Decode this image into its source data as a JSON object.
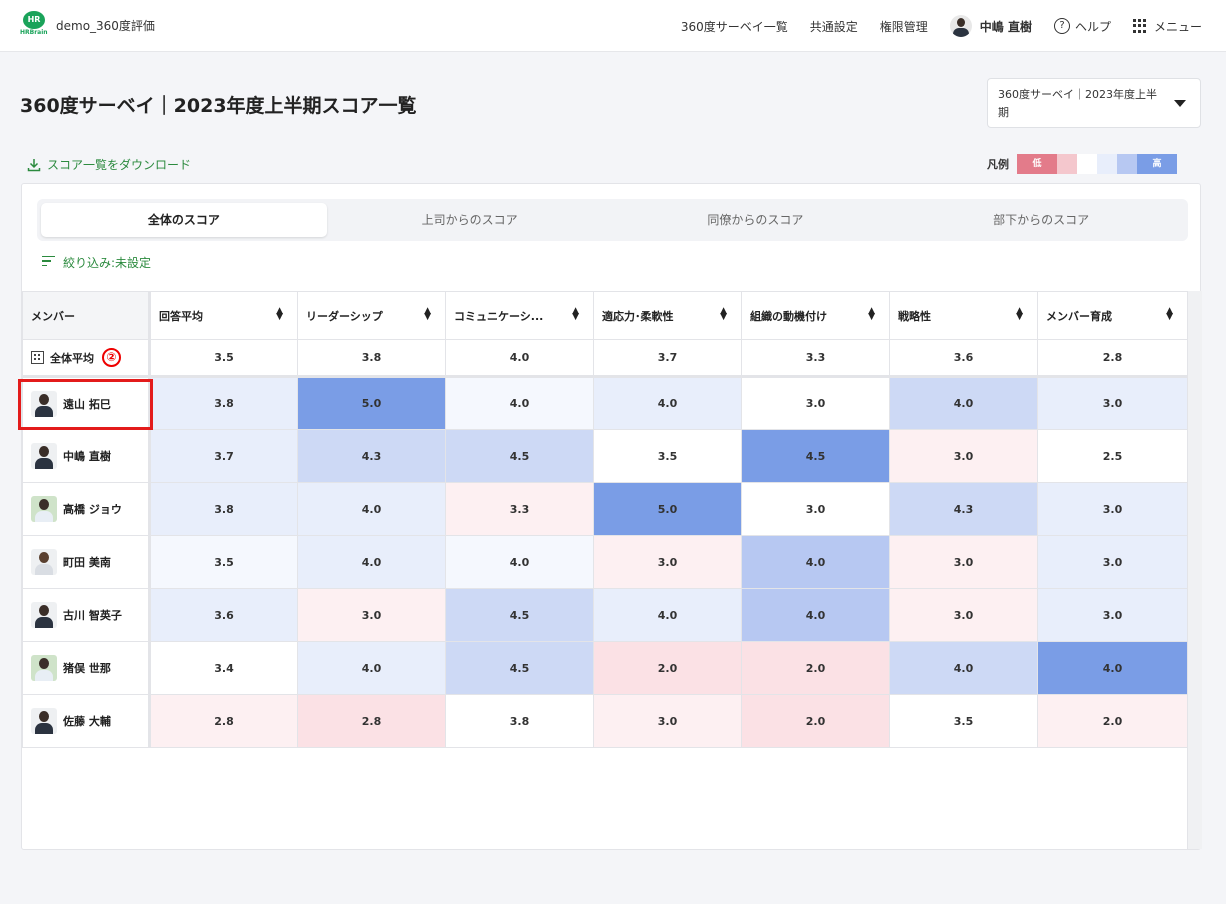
{
  "header": {
    "logo_text": "HR",
    "logo_sub": "HRBrain",
    "org": "demo_360度評価",
    "nav": [
      "360度サーベイ一覧",
      "共通設定",
      "権限管理"
    ],
    "user": "中嶋 直樹",
    "help": "ヘルプ",
    "menu": "メニュー"
  },
  "page": {
    "title": "360度サーベイ｜2023年度上半期スコア一覧",
    "select_value": "360度サーベイ｜2023年度上半期",
    "download_label": "スコア一覧をダウンロード",
    "legend_label": "凡例",
    "legend_low": "低",
    "legend_high": "高"
  },
  "tabs": [
    "全体のスコア",
    "上司からのスコア",
    "同僚からのスコア",
    "部下からのスコア"
  ],
  "filter_label": "絞り込み:未設定",
  "table": {
    "member_header": "メンバー",
    "columns": [
      "回答平均",
      "リーダーシップ",
      "コミュニケーシ...",
      "適応力･柔軟性",
      "組織の動機付け",
      "戦略性",
      "メンバー育成"
    ],
    "average_label": "全体平均",
    "average_badge": "②",
    "average_values": [
      "3.5",
      "3.8",
      "4.0",
      "3.7",
      "3.3",
      "3.6",
      "2.8"
    ],
    "rows": [
      {
        "name": "遠山 拓巳",
        "values": [
          "3.8",
          "5.0",
          "4.0",
          "4.0",
          "3.0",
          "4.0",
          "3.0"
        ]
      },
      {
        "name": "中嶋 直樹",
        "values": [
          "3.7",
          "4.3",
          "4.5",
          "3.5",
          "4.5",
          "3.0",
          "2.5"
        ]
      },
      {
        "name": "高橋 ジョウ",
        "values": [
          "3.8",
          "4.0",
          "3.3",
          "5.0",
          "3.0",
          "4.3",
          "3.0"
        ]
      },
      {
        "name": "町田 美南",
        "values": [
          "3.5",
          "4.0",
          "4.0",
          "3.0",
          "4.0",
          "3.0",
          "3.0"
        ]
      },
      {
        "name": "古川 智英子",
        "values": [
          "3.6",
          "3.0",
          "4.5",
          "4.0",
          "4.0",
          "3.0",
          "3.0"
        ]
      },
      {
        "name": "猪俣 世那",
        "values": [
          "3.4",
          "4.0",
          "4.5",
          "2.0",
          "2.0",
          "4.0",
          "4.0"
        ]
      },
      {
        "name": "佐藤 大輔",
        "values": [
          "2.8",
          "2.8",
          "3.8",
          "3.0",
          "2.0",
          "3.5",
          "2.0"
        ]
      }
    ]
  },
  "colors": {
    "accent_green": "#2b8a3e",
    "legend": [
      "#e37b8a",
      "#f4c7cd",
      "#ffffff",
      "#e8eefb",
      "#b7c8f2",
      "#7a9de6"
    ],
    "highlight": "#e31b1b"
  }
}
